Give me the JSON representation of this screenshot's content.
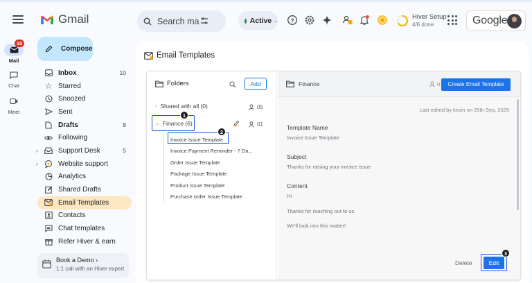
{
  "header": {
    "app_name": "Gmail",
    "search_placeholder": "Search ma",
    "status_label": "Active",
    "hiver_title": "Hiver Setup",
    "hiver_progress": "4/6 done",
    "google_word": "Google"
  },
  "rail": {
    "items": [
      {
        "label": "Mail",
        "badge": "10"
      },
      {
        "label": "Chat"
      },
      {
        "label": "Meet"
      }
    ]
  },
  "compose_label": "Compose",
  "nav": [
    {
      "label": "Inbox",
      "count": "10",
      "bold": true,
      "icon": "inbox-icon"
    },
    {
      "label": "Starred",
      "icon": "star-icon"
    },
    {
      "label": "Snoozed",
      "icon": "clock-icon"
    },
    {
      "label": "Sent",
      "icon": "send-icon"
    },
    {
      "label": "Drafts",
      "count": "8",
      "bold": true,
      "icon": "draft-icon"
    },
    {
      "label": "Following",
      "icon": "eye-icon"
    },
    {
      "label": "Support Desk",
      "count": "5",
      "icon": "tray-icon",
      "caret": true
    },
    {
      "label": "Website support",
      "icon": "chat-bubble-icon",
      "caret": true
    },
    {
      "label": "Analytics",
      "icon": "pie-chart-icon"
    },
    {
      "label": "Shared Drafts",
      "icon": "edit-box-icon"
    },
    {
      "label": "Email Templates",
      "icon": "template-icon",
      "active": true
    },
    {
      "label": "Contacts",
      "icon": "contacts-icon"
    },
    {
      "label": "Chat templates",
      "icon": "chat-template-icon"
    },
    {
      "label": "Refer Hiver & earn",
      "icon": "gift-icon"
    }
  ],
  "demo": {
    "title": "Book a Demo  ›",
    "subtitle": "1:1 call with an Hiver expert"
  },
  "main": {
    "title": "Email Templates",
    "folders": {
      "header": "Folders",
      "add_label": "Add",
      "shared": {
        "label": "Shared with all (0)",
        "count": "05"
      },
      "finance": {
        "label": "Finance (6)",
        "count": "01"
      },
      "templates": [
        "Invoice Issue Template",
        "Invoice Payment Reminder - 7 Da...",
        "Order Issue Template",
        "Package Issue Template",
        "Product Issue Template",
        "Purchase order Issue Template"
      ]
    },
    "detail": {
      "folder_name": "Finance",
      "count": "01",
      "create_label": "Create Email Template",
      "last_edited": "Last edited by kevin on 25th Sep, 2025",
      "template_name_label": "Template Name",
      "template_name_value": "Invoice Issue Template",
      "subject_label": "Subject",
      "subject_value": "Thanks for raising your invoice issue",
      "content_label": "Content",
      "content_lines": [
        "Hi",
        "Thanks for reaching out to us.",
        "We'll look into this matter!"
      ],
      "delete_label": "Delete",
      "edit_label": "Edit"
    },
    "steps": [
      "1",
      "2",
      "3"
    ]
  },
  "colors": {
    "accent": "#1a73e8",
    "highlight": "#1a56d6",
    "active_nav": "#fde6c2",
    "compose_bg": "#c2e7ff"
  }
}
